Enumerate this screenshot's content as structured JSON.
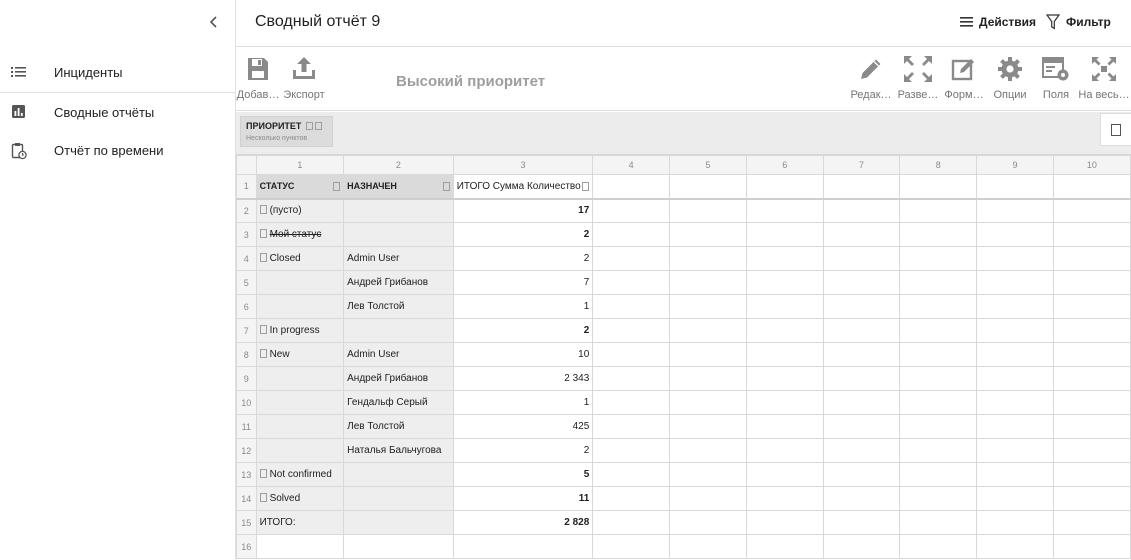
{
  "sidebar": {
    "items": [
      {
        "label": "Инциденты",
        "icon": "list-icon"
      },
      {
        "label": "Сводные отчёты",
        "icon": "bar-chart-icon"
      },
      {
        "label": "Отчёт по времени",
        "icon": "clipboard-clock-icon"
      }
    ]
  },
  "header": {
    "title": "Сводный отчёт 9",
    "actions_label": "Действия",
    "filter_label": "Фильтр"
  },
  "toolbar": {
    "add_label": "Добав…",
    "export_label": "Экспорт",
    "subtitle": "Высокий приоритет",
    "edit_label": "Редак…",
    "expand_label": "Разве…",
    "format_label": "Форм…",
    "options_label": "Опции",
    "fields_label": "Поля",
    "fullscreen_label": "На весь…"
  },
  "filter": {
    "name": "ПРИОРИТЕТ",
    "subtitle": "Несколько пунктов"
  },
  "grid": {
    "col_numbers": [
      "1",
      "2",
      "3",
      "4",
      "5",
      "6",
      "7",
      "8",
      "9",
      "10"
    ],
    "headers": {
      "status": "СТАТУС",
      "assigned": "НАЗНАЧЕН",
      "total": "ИТОГО Сумма Количество"
    },
    "rows": [
      {
        "n": "2",
        "status": "(пусто)",
        "assignee": "",
        "value": "17",
        "bold": true,
        "box": true
      },
      {
        "n": "3",
        "status": "Мой статус",
        "assignee": "",
        "value": "2",
        "bold": true,
        "box": true,
        "strike": true
      },
      {
        "n": "4",
        "status": "Closed",
        "assignee": "Admin User",
        "value": "2",
        "bold": false,
        "box": true
      },
      {
        "n": "5",
        "status": "",
        "assignee": "Андрей Грибанов",
        "value": "7",
        "bold": false,
        "box": false
      },
      {
        "n": "6",
        "status": "",
        "assignee": "Лев Толстой",
        "value": "1",
        "bold": false,
        "box": false
      },
      {
        "n": "7",
        "status": "In progress",
        "assignee": "",
        "value": "2",
        "bold": true,
        "box": true
      },
      {
        "n": "8",
        "status": "New",
        "assignee": "Admin User",
        "value": "10",
        "bold": false,
        "box": true
      },
      {
        "n": "9",
        "status": "",
        "assignee": "Андрей Грибанов",
        "value": "2 343",
        "bold": false,
        "box": false
      },
      {
        "n": "10",
        "status": "",
        "assignee": "Гендальф Серый",
        "value": "1",
        "bold": false,
        "box": false
      },
      {
        "n": "11",
        "status": "",
        "assignee": "Лев Толстой",
        "value": "425",
        "bold": false,
        "box": false
      },
      {
        "n": "12",
        "status": "",
        "assignee": "Наталья Бальчугова",
        "value": "2",
        "bold": false,
        "box": false
      },
      {
        "n": "13",
        "status": "Not confirmed",
        "assignee": "",
        "value": "5",
        "bold": true,
        "box": true
      },
      {
        "n": "14",
        "status": "Solved",
        "assignee": "",
        "value": "11",
        "bold": true,
        "box": true
      }
    ],
    "total": {
      "n": "15",
      "label": "ИТОГО:",
      "value": "2 828"
    },
    "empty_row_n": "16"
  },
  "colors": {
    "accent": "#757575",
    "header_cell": "#dadada",
    "grey_cell": "#eeeeee"
  }
}
